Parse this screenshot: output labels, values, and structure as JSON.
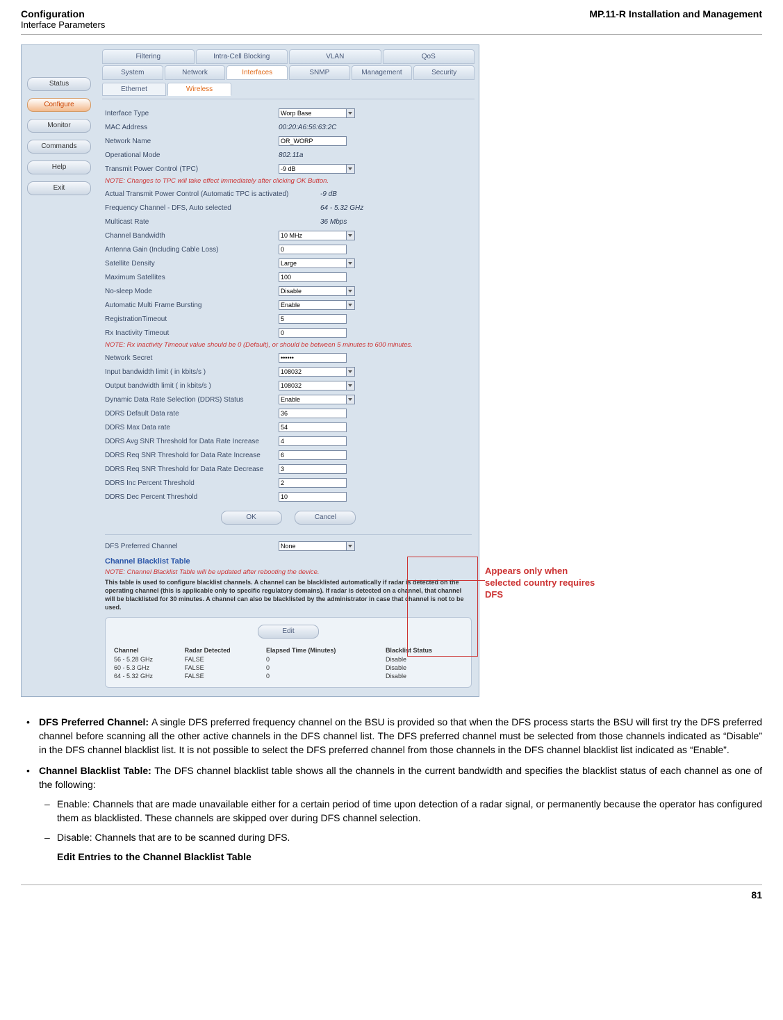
{
  "header": {
    "left_title": "Configuration",
    "left_sub": "Interface Parameters",
    "right": "MP.11-R Installation and Management"
  },
  "sidebar": {
    "items": [
      "Status",
      "Configure",
      "Monitor",
      "Commands",
      "Help",
      "Exit"
    ],
    "active_index": 1
  },
  "tabs": {
    "row1": [
      "Filtering",
      "Intra-Cell Blocking",
      "VLAN",
      "QoS"
    ],
    "row2": [
      "System",
      "Network",
      "Interfaces",
      "SNMP",
      "Management",
      "Security"
    ],
    "active_row2": 2,
    "sub": [
      "Ethernet",
      "Wireless"
    ],
    "active_sub": 1
  },
  "form": {
    "interface_type_lbl": "Interface Type",
    "interface_type_val": "Worp Base",
    "mac_lbl": "MAC Address",
    "mac_val": "00:20:A6:56:63:2C",
    "netname_lbl": "Network Name",
    "netname_val": "OR_WORP",
    "opmode_lbl": "Operational Mode",
    "opmode_val": "802.11a",
    "tpc_lbl": "Transmit Power Control (TPC)",
    "tpc_val": "-9 dB",
    "note1": "NOTE: Changes to TPC will take effect immediately after clicking OK Button.",
    "atpc_lbl": "Actual Transmit Power Control (Automatic TPC is activated)",
    "atpc_val": "-9 dB",
    "freq_lbl": "Frequency Channel - DFS, Auto selected",
    "freq_val": "64 - 5.32 GHz",
    "mcast_lbl": "Multicast Rate",
    "mcast_val": "36 Mbps",
    "bw_lbl": "Channel Bandwidth",
    "bw_val": "10 MHz",
    "ant_lbl": "Antenna Gain (Including Cable Loss)",
    "ant_val": "0",
    "satd_lbl": "Satellite Density",
    "satd_val": "Large",
    "maxsat_lbl": "Maximum Satellites",
    "maxsat_val": "100",
    "nosleep_lbl": "No-sleep Mode",
    "nosleep_val": "Disable",
    "amfb_lbl": "Automatic Multi Frame Bursting",
    "amfb_val": "Enable",
    "regto_lbl": "RegistrationTimeout",
    "regto_val": "5",
    "rxin_lbl": "Rx Inactivity Timeout",
    "rxin_val": "0",
    "note2": "NOTE: Rx inactivity Timeout value should be 0 (Default), or should be between 5 minutes to 600 minutes.",
    "secret_lbl": "Network Secret",
    "secret_val": "••••••",
    "inbw_lbl": "Input bandwidth limit ( in kbits/s )",
    "inbw_val": "108032",
    "outbw_lbl": "Output bandwidth limit ( in kbits/s )",
    "outbw_val": "108032",
    "ddrs_lbl": "Dynamic Data Rate Selection (DDRS) Status",
    "ddrs_val": "Enable",
    "ddrsdef_lbl": "DDRS Default Data rate",
    "ddrsdef_val": "36",
    "ddrsmax_lbl": "DDRS Max Data rate",
    "ddrsmax_val": "54",
    "ddrsavg_lbl": "DDRS Avg SNR Threshold for Data Rate Increase",
    "ddrsavg_val": "4",
    "ddrsreqi_lbl": "DDRS Req SNR Threshold for Data Rate Increase",
    "ddrsreqi_val": "6",
    "ddrsreqd_lbl": "DDRS Req SNR Threshold for Data Rate Decrease",
    "ddrsreqd_val": "3",
    "ddrsinc_lbl": "DDRS Inc Percent Threshold",
    "ddrsinc_val": "2",
    "ddrsdec_lbl": "DDRS Dec Percent Threshold",
    "ddrsdec_val": "10",
    "ok": "OK",
    "cancel": "Cancel",
    "dfspref_lbl": "DFS Preferred Channel",
    "dfspref_val": "None",
    "cbt_title": "Channel Blacklist Table",
    "note3": "NOTE: Channel Blacklist Table will be updated after rebooting the device.",
    "cbt_desc": "This table is used to configure blacklist channels. A channel can be blacklisted automatically if radar is detected on the operating channel (this is applicable only to specific regulatory domains). If radar is detected on a channel, that channel will be blacklisted for 30 minutes. A channel can also be blacklisted by the administrator in case that channel is not to be used.",
    "edit": "Edit",
    "th": [
      "Channel",
      "Radar Detected",
      "Elapsed Time (Minutes)",
      "Blacklist Status"
    ],
    "rows": [
      [
        "56 - 5.28 GHz",
        "FALSE",
        "0",
        "Disable"
      ],
      [
        "60 - 5.3 GHz",
        "FALSE",
        "0",
        "Disable"
      ],
      [
        "64 - 5.32 GHz",
        "FALSE",
        "0",
        "Disable"
      ]
    ]
  },
  "callout": "Appears only when selected country requires DFS",
  "body": {
    "dfs_b": "DFS Preferred Channel: ",
    "dfs_t": "A single DFS preferred frequency channel on the BSU is provided so that when the DFS process starts the BSU will first try the DFS preferred channel before scanning all the other active channels in the DFS channel list. The DFS preferred channel must be selected from those channels indicated as “Disable” in the DFS channel blacklist list. It is not possible to select the DFS preferred channel from those channels in the DFS channel blacklist list indicated as “Enable”.",
    "cbt_b": "Channel Blacklist Table: ",
    "cbt_t": "The DFS channel blacklist table shows all the channels in the current bandwidth and specifies the blacklist status of each channel as one of the following:",
    "en_t": "Enable: Channels that are made unavailable either for a certain period of time upon detection of a radar signal, or permanently because the operator has configured them as blacklisted. These channels are skipped over during DFS channel selection.",
    "dis_t": "Disable: Channels that are to be scanned during DFS.",
    "subh": "Edit Entries to the Channel Blacklist Table"
  },
  "page_num": "81"
}
